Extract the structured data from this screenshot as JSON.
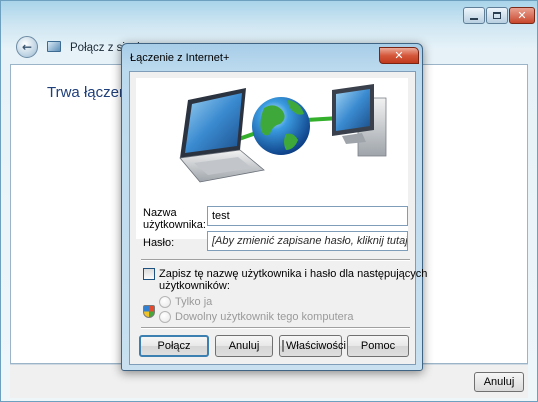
{
  "outer_window": {
    "title": "Połącz z sieci",
    "status_text": "Trwa łączenie",
    "cancel_label": "Anuluj"
  },
  "dialog": {
    "title": "Łączenie z Internet+",
    "username_label_line1": "Nazwa",
    "username_label_line2": "użytkownika:",
    "username_value": "test",
    "password_label": "Hasło:",
    "password_placeholder": "[Aby zmienić zapisane hasło, kliknij tutaj]",
    "save_checkbox": {
      "checked": false,
      "label_line1": "Zapisz tę nazwę użytkownika i hasło dla następujących",
      "label_line2": "użytkowników:"
    },
    "radio_options": [
      {
        "label": "Tylko ja",
        "enabled": false
      },
      {
        "label": "Dowolny użytkownik tego komputera",
        "enabled": false
      }
    ],
    "buttons": {
      "connect": "Połącz",
      "cancel": "Anuluj",
      "properties": "Właściwości",
      "help": "Pomoc"
    }
  },
  "colors": {
    "aero_glass": "#bcdaee",
    "close_red": "#c8472c",
    "status_text_blue": "#1f3f7a",
    "default_button_border": "#3c7fb1"
  },
  "icons": [
    "back-arrow-icon",
    "network-icon",
    "minimize-icon",
    "maximize-icon",
    "close-icon",
    "laptop-icon",
    "globe-icon",
    "desktop-computer-icon",
    "uac-shield-icon"
  ]
}
